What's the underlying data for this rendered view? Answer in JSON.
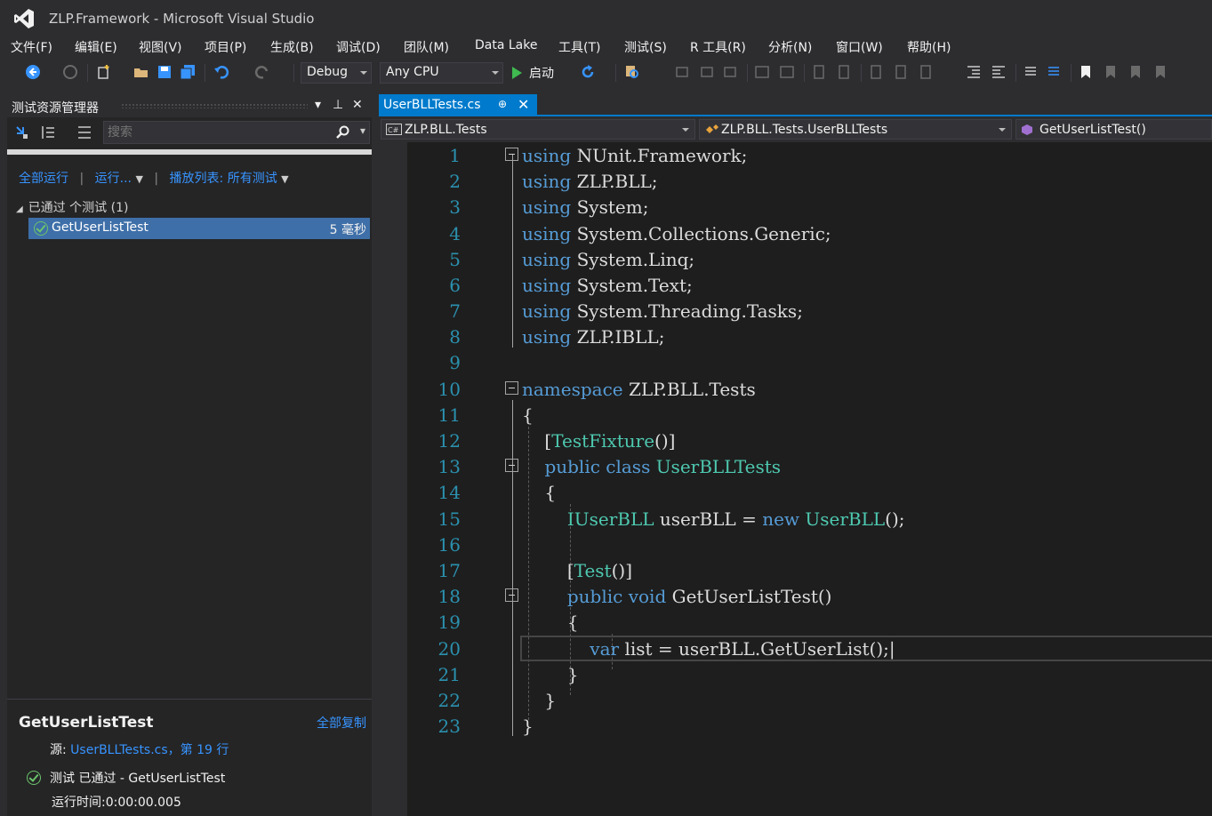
{
  "window": {
    "title": "ZLP.Framework - Microsoft Visual Studio"
  },
  "menu": [
    "文件(F)",
    "编辑(E)",
    "视图(V)",
    "项目(P)",
    "生成(B)",
    "调试(D)",
    "团队(M)",
    "Data Lake",
    "工具(T)",
    "测试(S)",
    "R 工具(R)",
    "分析(N)",
    "窗口(W)",
    "帮助(H)"
  ],
  "toolbar": {
    "configuration": "Debug",
    "platform": "Any CPU",
    "start_label": "启动"
  },
  "test_explorer": {
    "title": "测试资源管理器",
    "search_placeholder": "搜索",
    "run_all": "全部运行",
    "run": "运行...",
    "playlist": "播放列表: 所有测试",
    "group_label": "已通过 个测试 (1)",
    "tests": [
      {
        "name": "GetUserListTest",
        "duration": "5 毫秒",
        "status": "passed"
      }
    ],
    "details": {
      "name": "GetUserListTest",
      "copy_all": "全部复制",
      "source_label": "源:",
      "source_link": "UserBLLTests.cs，第 19 行",
      "result": "测试 已通过 - GetUserListTest",
      "elapsed": "运行时间:0:00:00.005"
    }
  },
  "editor": {
    "tab": {
      "label": "UserBLLTests.cs",
      "pin": "⊕",
      "close": "✕"
    },
    "nav": {
      "project": "ZLP.BLL.Tests",
      "type": "ZLP.BLL.Tests.UserBLLTests",
      "member": "GetUserListTest()"
    },
    "line_numbers": [
      "1",
      "2",
      "3",
      "4",
      "5",
      "6",
      "7",
      "8",
      "9",
      "10",
      "11",
      "12",
      "13",
      "14",
      "15",
      "16",
      "17",
      "18",
      "19",
      "20",
      "21",
      "22",
      "23"
    ]
  },
  "colors": {
    "accent": "#007acc",
    "keyword": "#569cd6",
    "type": "#4ec9b0",
    "line_number": "#2b91af",
    "link": "#3794ff",
    "pass": "#6bc46b"
  }
}
